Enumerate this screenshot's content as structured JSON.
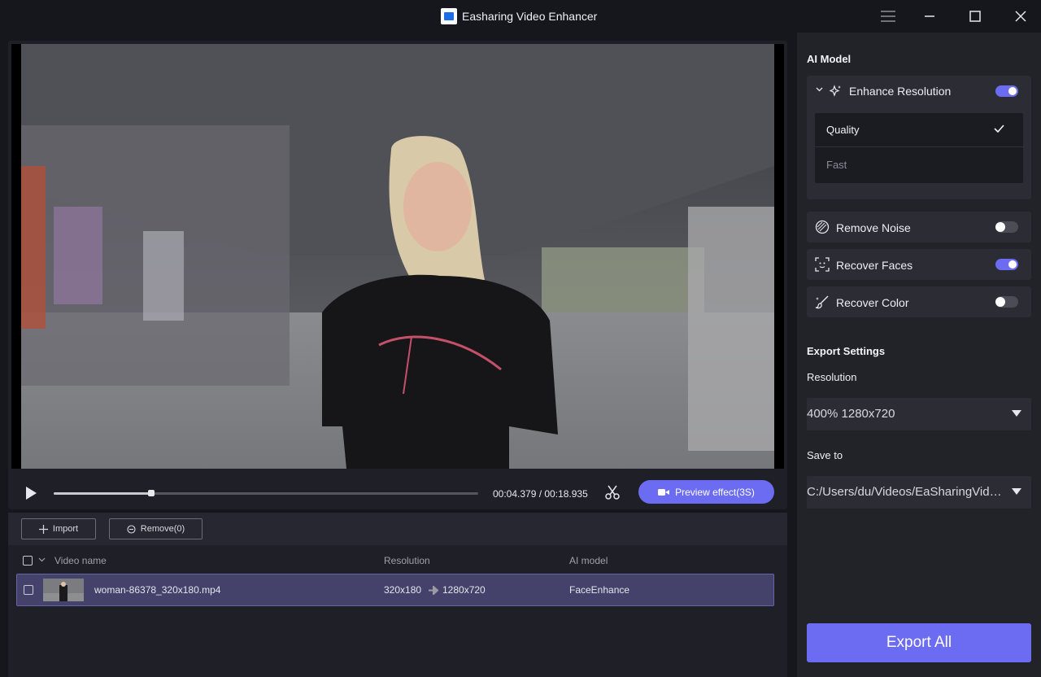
{
  "window": {
    "title": "Easharing Video Enhancer"
  },
  "player": {
    "current_time": "00:04.379",
    "total_time": "00:18.935",
    "time_display": "00:04.379 / 00:18.935",
    "progress": 0.229,
    "preview_label": "Preview effect(3S)"
  },
  "filelist": {
    "import_label": "Import",
    "remove_label": "Remove(0)",
    "columns": {
      "name": "Video name",
      "resolution": "Resolution",
      "model": "AI model"
    },
    "rows": [
      {
        "name": "woman-86378_320x180.mp4",
        "from_res": "320x180",
        "to_res": "1280x720",
        "model": "FaceEnhance",
        "selected": true,
        "checked": false
      }
    ]
  },
  "panel": {
    "ai_model_title": "AI Model",
    "enhance": {
      "label": "Enhance Resolution",
      "enabled": true,
      "options": [
        {
          "label": "Quality",
          "selected": true
        },
        {
          "label": "Fast",
          "selected": false
        }
      ]
    },
    "models": [
      {
        "label": "Remove Noise",
        "enabled": false,
        "icon": "noise-icon"
      },
      {
        "label": "Recover Faces",
        "enabled": true,
        "icon": "face-scan-icon"
      },
      {
        "label": "Recover Color",
        "enabled": false,
        "icon": "color-brush-icon"
      }
    ],
    "export_title": "Export Settings",
    "resolution_label": "Resolution",
    "resolution_value": "400% 1280x720",
    "save_label": "Save to",
    "save_path": "C:/Users/du/Videos/EaSharingVideoEnhancer",
    "export_button": "Export All"
  },
  "colors": {
    "accent": "#6c6cf2",
    "panel_bg": "#222329",
    "row_selected": "#44426a"
  }
}
